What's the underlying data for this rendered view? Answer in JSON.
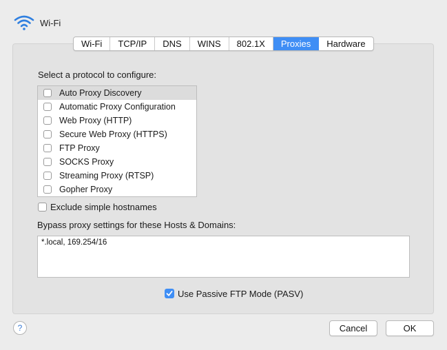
{
  "header": {
    "title": "Wi-Fi",
    "icon": "wifi-icon"
  },
  "tabs": [
    {
      "label": "Wi-Fi",
      "active": false
    },
    {
      "label": "TCP/IP",
      "active": false
    },
    {
      "label": "DNS",
      "active": false
    },
    {
      "label": "WINS",
      "active": false
    },
    {
      "label": "802.1X",
      "active": false
    },
    {
      "label": "Proxies",
      "active": true
    },
    {
      "label": "Hardware",
      "active": false
    }
  ],
  "protocols": {
    "heading": "Select a protocol to configure:",
    "items": [
      {
        "label": "Auto Proxy Discovery",
        "checked": false,
        "selected": true
      },
      {
        "label": "Automatic Proxy Configuration",
        "checked": false,
        "selected": false
      },
      {
        "label": "Web Proxy (HTTP)",
        "checked": false,
        "selected": false
      },
      {
        "label": "Secure Web Proxy (HTTPS)",
        "checked": false,
        "selected": false
      },
      {
        "label": "FTP Proxy",
        "checked": false,
        "selected": false
      },
      {
        "label": "SOCKS Proxy",
        "checked": false,
        "selected": false
      },
      {
        "label": "Streaming Proxy (RTSP)",
        "checked": false,
        "selected": false
      },
      {
        "label": "Gopher Proxy",
        "checked": false,
        "selected": false
      }
    ]
  },
  "exclude": {
    "label": "Exclude simple hostnames",
    "checked": false
  },
  "bypass": {
    "heading": "Bypass proxy settings for these Hosts & Domains:",
    "value": "*.local, 169.254/16"
  },
  "pasv": {
    "label": "Use Passive FTP Mode (PASV)",
    "checked": true
  },
  "footer": {
    "help_label": "?",
    "cancel_label": "Cancel",
    "ok_label": "OK"
  },
  "colors": {
    "accent": "#3f8ef5",
    "selected_row": "#dcdcdc",
    "panel": "#e3e3e3",
    "window": "#ececec"
  }
}
